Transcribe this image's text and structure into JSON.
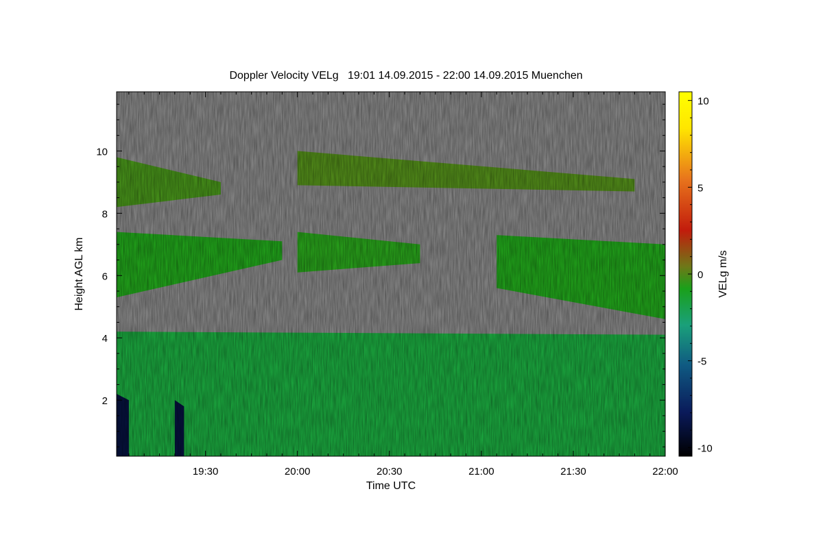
{
  "chart_data": {
    "type": "heatmap",
    "title": "Doppler Velocity VELg   19:01 14.09.2015 - 22:00 14.09.2015 Muenchen",
    "xlabel": "Time UTC",
    "ylabel": "Height AGL km",
    "colorbar_label": "VELg m/s",
    "xlim": [
      "19:01",
      "22:00"
    ],
    "x_ticks": [
      "19:30",
      "20:00",
      "20:30",
      "21:00",
      "21:30",
      "22:00"
    ],
    "ylim": [
      0.2,
      11.9
    ],
    "y_ticks": [
      2,
      4,
      6,
      8,
      10
    ],
    "colorbar_range": [
      -10.5,
      10.5
    ],
    "colorbar_ticks": [
      10,
      5,
      0,
      -5,
      -10
    ],
    "no_signal_color": "#808080",
    "colormap": [
      "#000000",
      "#0a1a5a",
      "#0f5a82",
      "#1aa07a",
      "#1aa01a",
      "#6e7818",
      "#c21c0c",
      "#e8741c",
      "#ffe600",
      "#ffff00"
    ],
    "layers": [
      {
        "name": "upper-cloud-west",
        "time": [
          "19:01",
          "19:35"
        ],
        "bottom_km": [
          8.2,
          8.6
        ],
        "top_km": [
          9.8,
          9.0
        ],
        "mean_velocity": 0
      },
      {
        "name": "upper-cloud-east",
        "time": [
          "20:00",
          "21:50"
        ],
        "bottom_km": [
          8.9,
          8.7
        ],
        "top_km": [
          10.0,
          9.1
        ],
        "mean_velocity": 0.3
      },
      {
        "name": "mid-cloud-west",
        "time": [
          "19:01",
          "19:55"
        ],
        "bottom_km": [
          5.3,
          6.5
        ],
        "top_km": [
          7.4,
          7.1
        ],
        "mean_velocity": -1
      },
      {
        "name": "mid-cloud-centre",
        "time": [
          "20:00",
          "20:40"
        ],
        "bottom_km": [
          6.1,
          6.4
        ],
        "top_km": [
          7.4,
          7.0
        ],
        "mean_velocity": -0.8
      },
      {
        "name": "mid-cloud-east",
        "time": [
          "21:05",
          "22:00"
        ],
        "bottom_km": [
          5.6,
          4.6
        ],
        "top_km": [
          7.3,
          7.0
        ],
        "mean_velocity": -1
      },
      {
        "name": "lower-precipitation",
        "time": [
          "19:01",
          "22:00"
        ],
        "bottom_km": [
          0.2,
          0.2
        ],
        "top_km": [
          4.2,
          4.1
        ],
        "mean_velocity": -2
      },
      {
        "name": "fall-streak-1",
        "time": [
          "19:01",
          "19:05"
        ],
        "bottom_km": [
          0.2,
          0.2
        ],
        "top_km": [
          2.2,
          2.0
        ],
        "mean_velocity": -9
      },
      {
        "name": "fall-streak-2",
        "time": [
          "19:20",
          "19:23"
        ],
        "bottom_km": [
          0.2,
          0.2
        ],
        "top_km": [
          2.0,
          1.8
        ],
        "mean_velocity": -9
      }
    ]
  }
}
